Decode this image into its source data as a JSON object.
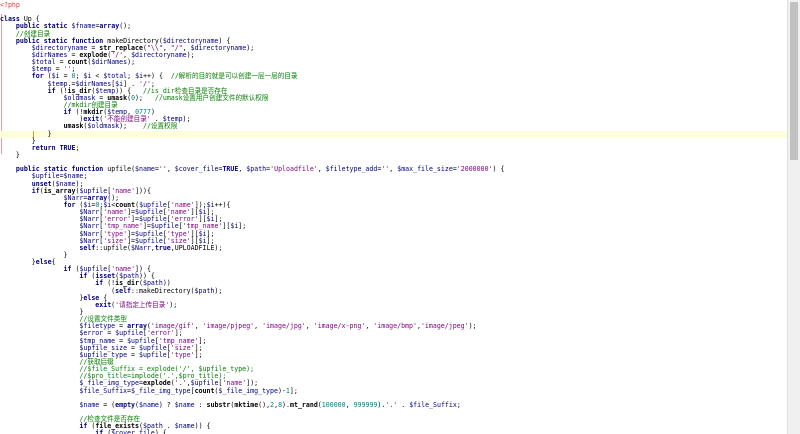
{
  "editor": {
    "lines": [
      "<?php",
      "",
      "class Up {",
      "    public static $fname=array();",
      "    //创建目录",
      "    public static function makeDirectory($directoryname) {",
      "        $directoryname = str_replace(\"\\\\\", \"/\", $directoryname);",
      "        $dirNames = explode('/', $directoryname);",
      "        $total = count($dirNames);",
      "        $temp = '';",
      "        for ($i = 0; $i < $total; $i++) {  //解析的目的就是可以创建一层一层的目录",
      "            $temp.=$dirNames[$i] . '/';",
      "            if (!is_dir($temp)) {   //is_dir检查目录是否存在",
      "                $oldmask = umask(0);   //umask设置用户创建文件的默认权限",
      "                //mkdir创建目录",
      "                if (!mkdir($temp, 0777)",
      "                    )exit('不能创建目录' . $temp);",
      "                umask($oldmask);    //设置权限",
      "            }",
      "        }",
      "        return TRUE;",
      "    }",
      "",
      "    public static function upfile($name='', $cover_file=TRUE, $path='Uploadfile', $filetype_add='', $max_file_size='2000000') {",
      "        $upfile=$name;",
      "        unset($name);",
      "        if(is_array($upfile['name'])){",
      "                $Narr=array();",
      "                for ($i=0;$i<count($upfile['name']);$i++){",
      "                    $Narr['name']=$upfile['name'][$i];",
      "                    $Narr['error']=$upfile['error'][$i];",
      "                    $Narr['tmp_name']=$upfile['tmp_name'][$i];",
      "                    $Narr['type']=$upfile['type'][$i];",
      "                    $Narr['size']=$upfile['size'][$i];",
      "                    self::upfile($Narr,true,UPLOADFILE);",
      "                }",
      "        }else{",
      "                if ($upfile['name']) {",
      "                    if (isset($path)) {",
      "                        if (!is_dir($path))",
      "                            (self::makeDirectory($path);",
      "                    }else {",
      "                        exit('请指定上传目录');",
      "                    }",
      "                    //设置文件类型",
      "                    $filetype = array('image/gif', 'image/pjpeg', 'image/jpg', 'image/x-png', 'image/bmp','image/jpeg');",
      "                    $error = $upfile['error'];",
      "                    $tmp_name = $upfile['tmp_name'];",
      "                    $upfile_size = $upfile['size'];",
      "                    $upfile_type = $upfile['type'];",
      "                    //获取后缀",
      "                    //$file_Suffix = explode('/', $upfile_type);",
      "                    //$pro_title=implode('.',$pro_title);",
      "                    $_file_img_type=explode('.',$upfile['name']);",
      "                    $file_Suffix=$_file_img_type[count($_file_img_type)-1];",
      "",
      "                    $name = (empty($name) ? $name : substr(mktime(),2,8).mt_rand(100000, 999999).'.' . $file_Suffix;",
      "",
      "                    //检查文件是否存在",
      "                    if (file_exists($path . $name)) {",
      "                        if ($cover_file) {",
      "                            unlink($path . $name);",
      "                        }else{"
    ]
  }
}
